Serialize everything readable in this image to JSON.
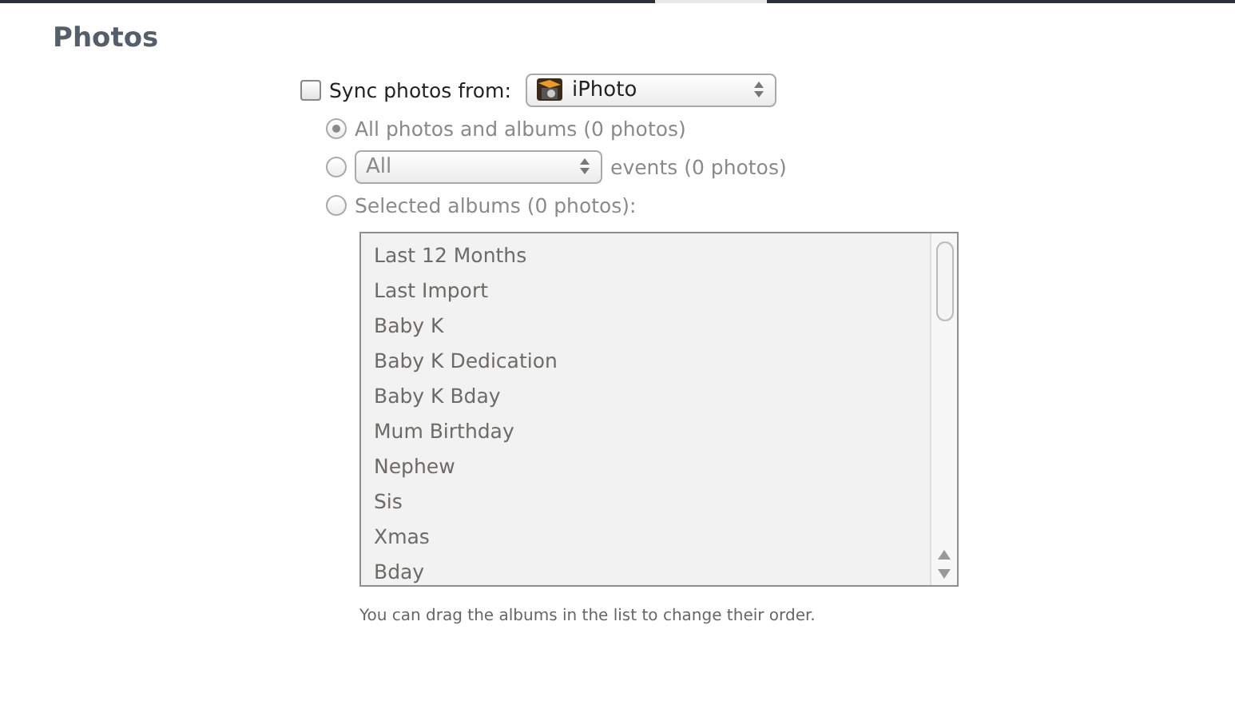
{
  "section": {
    "title": "Photos"
  },
  "sync": {
    "label": "Sync photos from:",
    "checked": false,
    "source": {
      "value": "iPhoto"
    }
  },
  "options": [
    {
      "kind": "plain",
      "label": "All photos and albums (0 photos)",
      "selected": true,
      "disabled": true
    },
    {
      "kind": "popup",
      "popup": {
        "value": "All"
      },
      "label": "events (0 photos)",
      "selected": false,
      "disabled": true
    },
    {
      "kind": "plain",
      "label": "Selected albums (0 photos):",
      "selected": false,
      "disabled": true
    }
  ],
  "albums": [
    {
      "label": "Last 12 Months"
    },
    {
      "label": "Last Import"
    },
    {
      "label": "Baby K"
    },
    {
      "label": "Baby K Dedication"
    },
    {
      "label": "Baby K Bday"
    },
    {
      "label": "Mum Birthday"
    },
    {
      "label": "Nephew"
    },
    {
      "label": "Sis"
    },
    {
      "label": "Xmas"
    },
    {
      "label": "Bday"
    }
  ],
  "hint": "You can drag the albums in the list to change their order."
}
